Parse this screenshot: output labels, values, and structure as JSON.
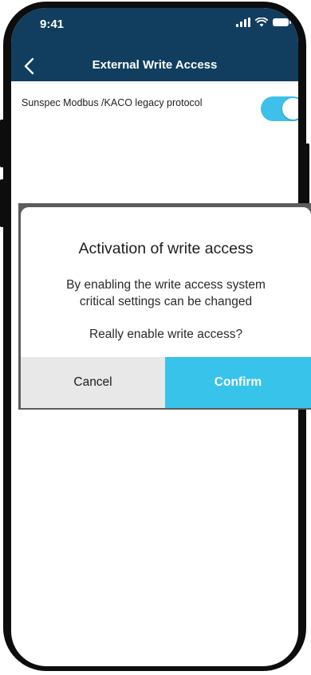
{
  "status_bar": {
    "time": "9:41",
    "icons": [
      "signal-icon",
      "wifi-icon",
      "battery-icon"
    ]
  },
  "nav": {
    "title": "External Write Access",
    "back_icon": "chevron-left-icon"
  },
  "setting": {
    "label": "Sunspec Modbus /KACO legacy protocol",
    "toggle_on": true
  },
  "dialog": {
    "title": "Activation of write access",
    "message": "By enabling the write access system\ncritical settings can be changed",
    "question": "Really enable write access?",
    "cancel_label": "Cancel",
    "confirm_label": "Confirm"
  },
  "colors": {
    "header": "#113e5f",
    "accent": "#38c3ea",
    "cancel_bg": "#e8e8e8",
    "overlay": "#5c5c5c"
  }
}
